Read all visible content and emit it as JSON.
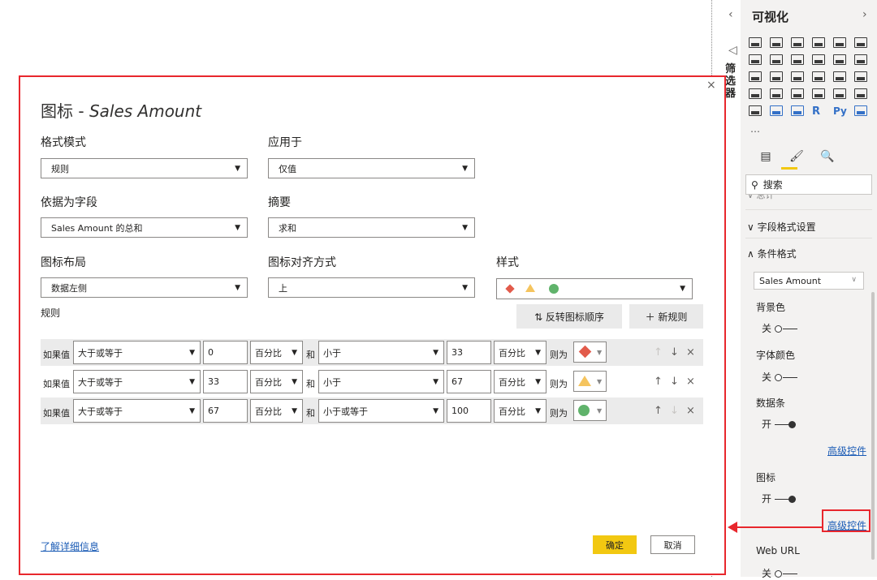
{
  "dialog": {
    "title_prefix": "图标 - ",
    "title_field": "Sales Amount",
    "close_glyph": "×",
    "format_mode": {
      "label": "格式模式",
      "value": "规则"
    },
    "apply_to": {
      "label": "应用于",
      "value": "仅值"
    },
    "based_on_field": {
      "label": "依据为字段",
      "value": "Sales Amount 的总和"
    },
    "summary": {
      "label": "摘要",
      "value": "求和"
    },
    "icon_layout": {
      "label": "图标布局",
      "value": "数据左侧"
    },
    "icon_alignment": {
      "label": "图标对齐方式",
      "value": "上"
    },
    "style": {
      "label": "样式"
    },
    "rules_label": "规则",
    "reverse_button": "⇅ 反转图标顺序",
    "new_rule_button": "＋ 新规则",
    "rules": [
      {
        "if_label": "如果值",
        "op1": "大于或等于",
        "v1": "0",
        "type1": "百分比",
        "and": "和",
        "op2": "小于",
        "v2": "33",
        "type2": "百分比",
        "then": "则为",
        "icon": "diamond"
      },
      {
        "if_label": "如果值",
        "op1": "大于或等于",
        "v1": "33",
        "type1": "百分比",
        "and": "和",
        "op2": "小于",
        "v2": "67",
        "type2": "百分比",
        "then": "则为",
        "icon": "triangle"
      },
      {
        "if_label": "如果值",
        "op1": "大于或等于",
        "v1": "67",
        "type1": "百分比",
        "and": "和",
        "op2": "小于或等于",
        "v2": "100",
        "type2": "百分比",
        "then": "则为",
        "icon": "circle"
      }
    ],
    "learn_more": "了解详细信息",
    "ok": "确定",
    "cancel": "取消"
  },
  "side": {
    "filter_label": "筛选器",
    "pane_title": "可视化",
    "chev_left": "‹",
    "chev_right": "›",
    "more": "…",
    "search_placeholder": "搜索",
    "partial_section": "∨ 总计",
    "field_format_section": "∨ 字段格式设置",
    "conditional_format_section": "∧ 条件格式",
    "field_select": "Sales Amount",
    "background_color": {
      "label": "背景色",
      "state": "关"
    },
    "font_color": {
      "label": "字体颜色",
      "state": "关"
    },
    "data_bars": {
      "label": "数据条",
      "state": "开"
    },
    "advanced_controls_1": "高级控件",
    "icons": {
      "label": "图标",
      "state": "开"
    },
    "advanced_controls_2": "高级控件",
    "web_url": {
      "label": "Web URL",
      "state": "关"
    }
  },
  "colors": {
    "accent_red": "#e8272d",
    "yellow": "#f2c811",
    "link": "#1a5bb5"
  }
}
